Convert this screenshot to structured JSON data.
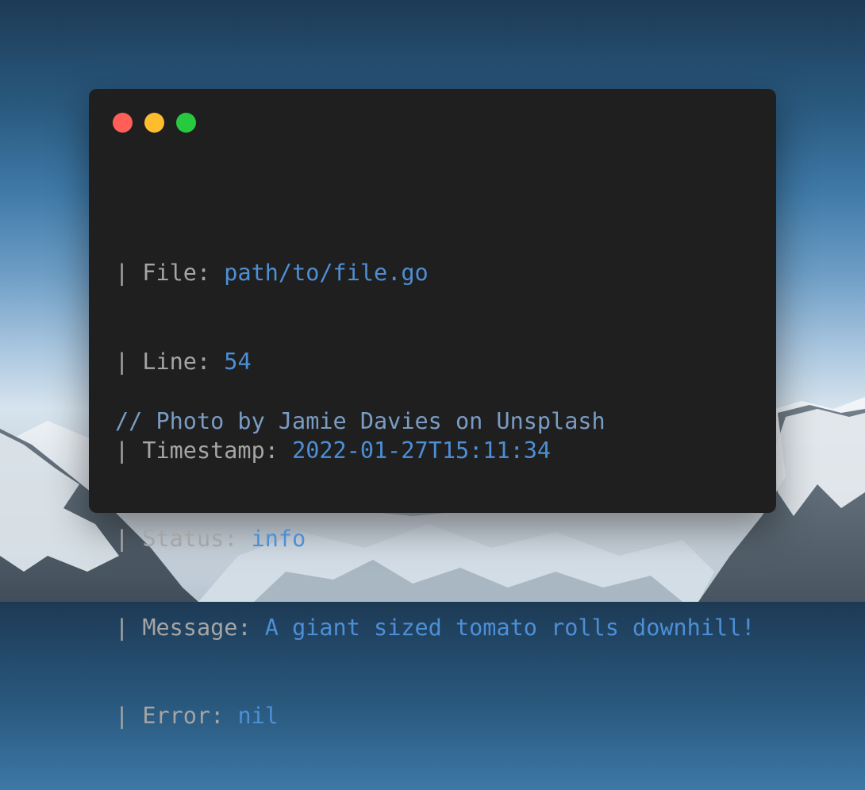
{
  "background": {
    "description_colors": {
      "sky_top": "#1d3a55",
      "sky_mid": "#3f7aa8",
      "snow": "#e8eef3",
      "rock": "#3d4b58"
    }
  },
  "window": {
    "background": "#1f1f1f",
    "traffic_lights": [
      {
        "name": "close",
        "color": "#ff5f56"
      },
      {
        "name": "minimize",
        "color": "#ffbd2e"
      },
      {
        "name": "maximize",
        "color": "#27c93f"
      }
    ]
  },
  "log": {
    "prefix": "| ",
    "key_color": "#a5a5a5",
    "value_color": "#4d8fd6",
    "rows": [
      {
        "key": "File: ",
        "value": "path/to/file.go"
      },
      {
        "key": "Line: ",
        "value": "54"
      },
      {
        "key": "Timestamp: ",
        "value": "2022-01-27T15:11:34"
      },
      {
        "key": "Status: ",
        "value": "info"
      },
      {
        "key": "Message: ",
        "value": "A giant sized tomato rolls downhill!"
      },
      {
        "key": "Error: ",
        "value": "nil"
      }
    ]
  },
  "comment": {
    "text": "// Photo by Jamie Davies on Unsplash",
    "color": "#7a9cc4"
  }
}
